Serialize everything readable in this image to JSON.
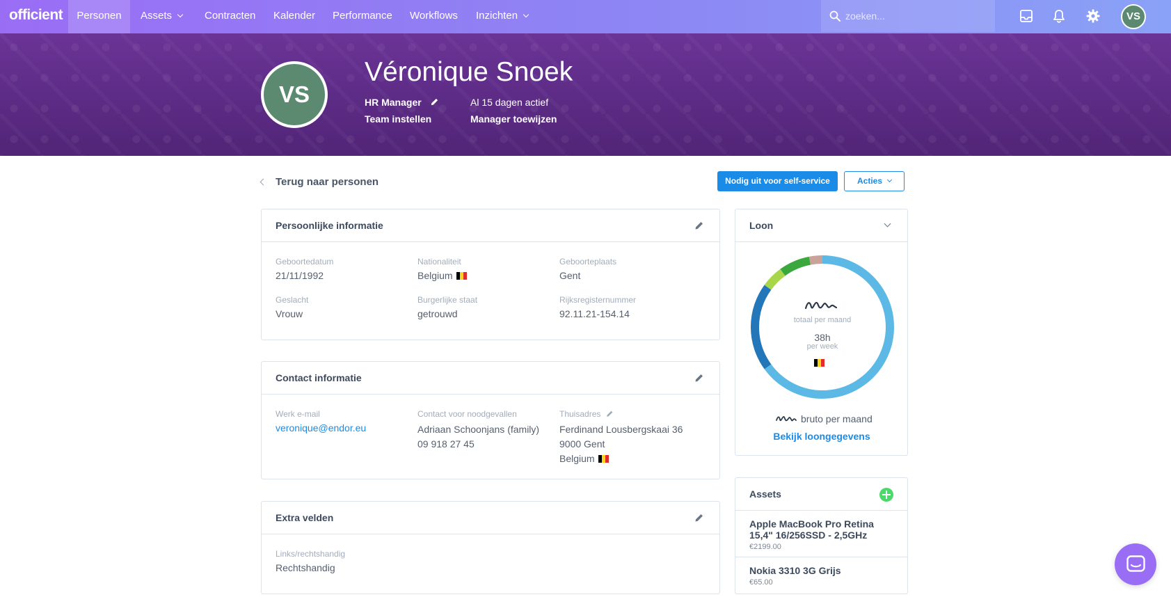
{
  "app": {
    "logo": "officient"
  },
  "nav": {
    "items": [
      {
        "label": "Personen",
        "active": true,
        "dropdown": false
      },
      {
        "label": "Assets",
        "active": false,
        "dropdown": true
      },
      {
        "label": "Contracten",
        "active": false,
        "dropdown": false
      },
      {
        "label": "Kalender",
        "active": false,
        "dropdown": false
      },
      {
        "label": "Performance",
        "active": false,
        "dropdown": false
      },
      {
        "label": "Workflows",
        "active": false,
        "dropdown": false
      },
      {
        "label": "Inzichten",
        "active": false,
        "dropdown": true
      }
    ],
    "search_placeholder": "zoeken...",
    "icons": [
      "inbox-icon",
      "bell-icon",
      "gear-icon"
    ],
    "user_initials": "VS"
  },
  "profile": {
    "initials": "VS",
    "name": "Véronique Snoek",
    "role": "HR Manager",
    "active_text": "Al 15 dagen actief",
    "team_link": "Team instellen",
    "manager_link": "Manager toewijzen"
  },
  "toolbar": {
    "back_label": "Terug naar personen",
    "invite_label": "Nodig uit voor self-service",
    "actions_label": "Acties"
  },
  "personal": {
    "title": "Persoonlijke informatie",
    "fields": [
      {
        "label": "Geboortedatum",
        "value": "21/11/1992"
      },
      {
        "label": "Nationaliteit",
        "value": "Belgium"
      },
      {
        "label": "Geboorteplaats",
        "value": "Gent"
      },
      {
        "label": "Geslacht",
        "value": "Vrouw"
      },
      {
        "label": "Burgerlijke staat",
        "value": "getrouwd"
      },
      {
        "label": "Rijksregisternummer",
        "value": "92.11.21-154.14"
      }
    ]
  },
  "contact": {
    "title": "Contact informatie",
    "email_label": "Werk e-mail",
    "email": "veronique@endor.eu",
    "emergency_label": "Contact voor noodgevallen",
    "emergency_name": "Adriaan Schoonjans (family)",
    "emergency_phone": "09 918 27 45",
    "address_label": "Thuisadres",
    "address_street": "Ferdinand Lousbergskaai 36",
    "address_city": "9000 Gent",
    "address_country": "Belgium"
  },
  "extra": {
    "title": "Extra velden",
    "field_label": "Links/rechtshandig",
    "field_value": "Rechtshandig"
  },
  "loon": {
    "title": "Loon",
    "total_label": "totaal per maand",
    "hours": "38h",
    "hours_label": "per week",
    "bruto_label": "bruto per maand",
    "link": "Bekijk loongegevens",
    "segments": [
      {
        "fraction": 0.03,
        "color": "#c9a39a"
      },
      {
        "fraction": 0.65,
        "color": "#5cb9e6"
      },
      {
        "fraction": 0.2,
        "color": "#2376b7"
      },
      {
        "fraction": 0.05,
        "color": "#a8d64a"
      },
      {
        "fraction": 0.07,
        "color": "#3aa83c"
      }
    ]
  },
  "assets": {
    "title": "Assets",
    "items": [
      {
        "name": "Apple MacBook Pro Retina 15,4\" 16/256SSD - 2,5GHz",
        "price": "€2199.00"
      },
      {
        "name": "Nokia 3310 3G Grijs",
        "price": "€65.00"
      }
    ]
  },
  "colors": {
    "accent": "#1a8be6",
    "nav_start": "#9a6df5",
    "nav_end": "#8aa2f7",
    "avatar": "#5b8a70",
    "banner": "#5a2a7e"
  }
}
